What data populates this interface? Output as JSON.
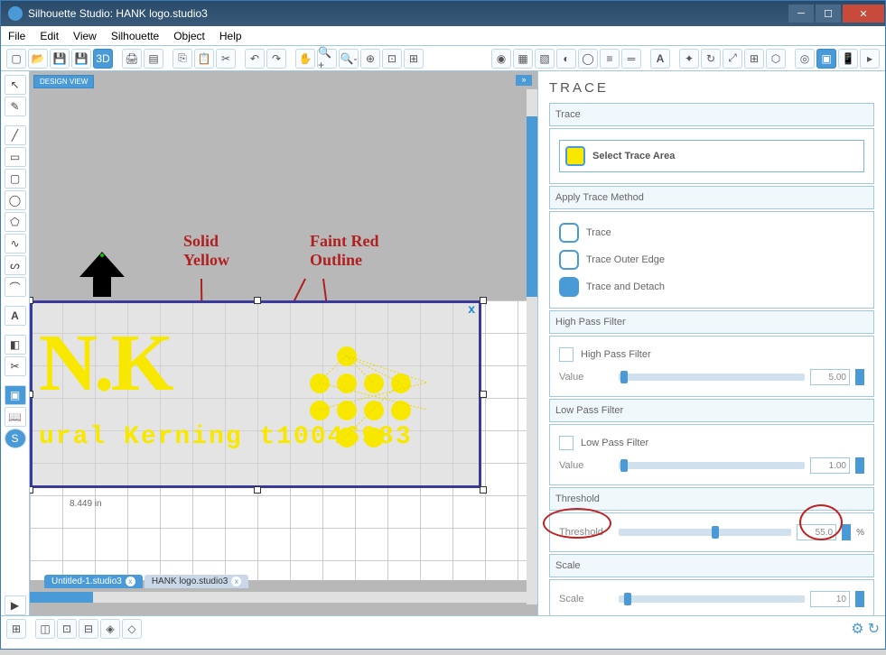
{
  "window": {
    "title": "Silhouette Studio: HANK logo.studio3"
  },
  "menubar": [
    "File",
    "Edit",
    "View",
    "Silhouette",
    "Object",
    "Help"
  ],
  "design_badge": "DESIGN VIEW",
  "tabs": [
    {
      "label": "Untitled-1.studio3",
      "active": true
    },
    {
      "label": "HANK logo.studio3",
      "active": false
    }
  ],
  "measurement": "8.449 in",
  "logo": {
    "main": "N.K",
    "sub": "ural Kerning t10046983"
  },
  "annotations": {
    "solid": "Solid\nYellow",
    "faint": "Faint Red\nOutline"
  },
  "panel": {
    "title": "TRACE",
    "trace_header": "Trace",
    "select_trace": "Select Trace Area",
    "apply_header": "Apply Trace Method",
    "trace_opt1": "Trace",
    "trace_opt2": "Trace Outer Edge",
    "trace_opt3": "Trace and Detach",
    "high_pass_header": "High Pass Filter",
    "high_pass_label": "High Pass Filter",
    "hp_value_label": "Value",
    "hp_value": "5.00",
    "low_pass_header": "Low Pass Filter",
    "low_pass_label": "Low Pass Filter",
    "lp_value_label": "Value",
    "lp_value": "1.00",
    "threshold_header": "Threshold",
    "threshold_label": "Threshold",
    "threshold_value": "55.0",
    "threshold_unit": "%",
    "scale_header": "Scale",
    "scale_label": "Scale",
    "scale_value": "10"
  }
}
